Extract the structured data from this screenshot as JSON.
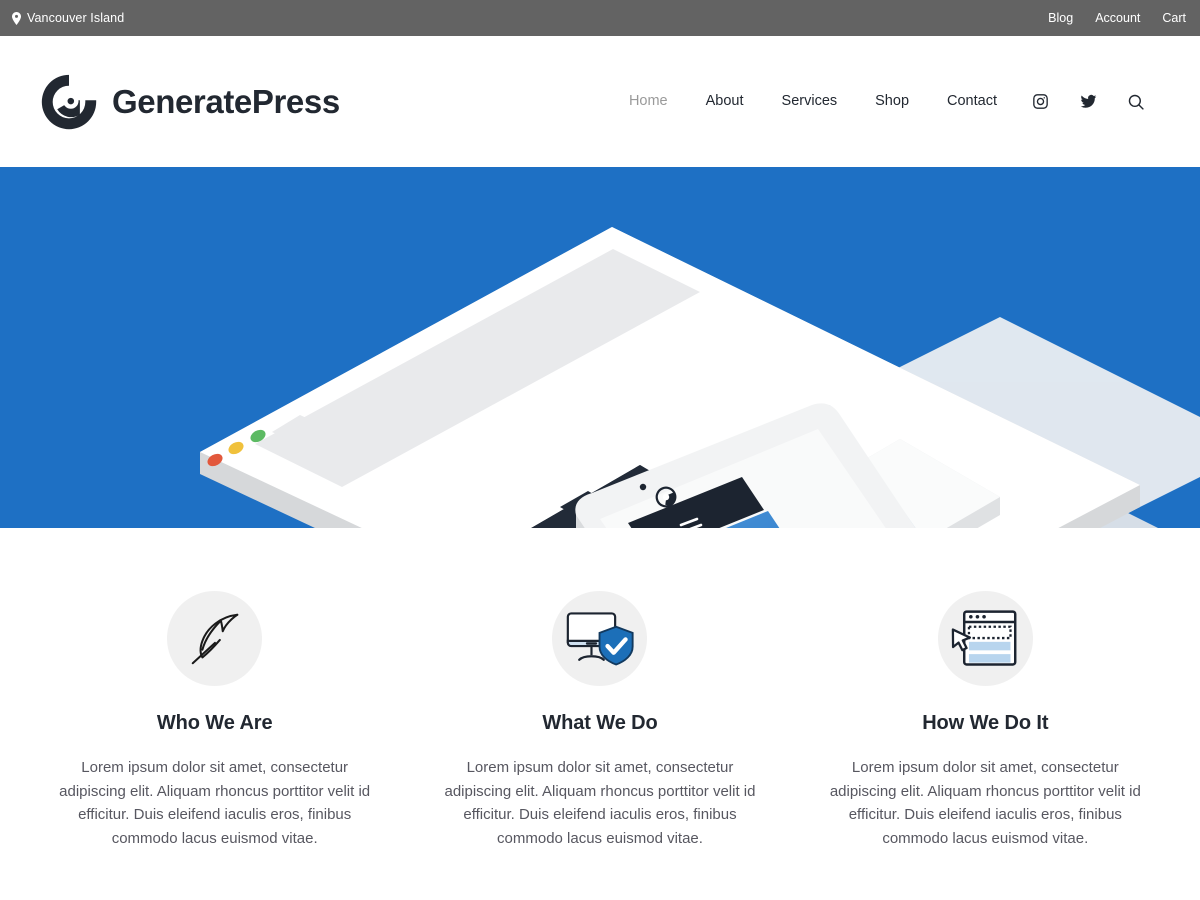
{
  "topbar": {
    "location_icon": "map-pin-icon",
    "location": "Vancouver Island",
    "links": [
      {
        "label": "Blog",
        "name": "blog"
      },
      {
        "label": "Account",
        "name": "account"
      },
      {
        "label": "Cart",
        "name": "cart"
      }
    ]
  },
  "header": {
    "logo_icon": "generatepress-logo-icon",
    "brand_name": "GeneratePress",
    "nav": [
      {
        "label": "Home",
        "current": true
      },
      {
        "label": "About",
        "current": false
      },
      {
        "label": "Services",
        "current": false
      },
      {
        "label": "Shop",
        "current": false
      },
      {
        "label": "Contact",
        "current": false
      }
    ],
    "icons": [
      {
        "name": "instagram-icon",
        "label": "Instagram"
      },
      {
        "name": "twitter-icon",
        "label": "Twitter"
      },
      {
        "name": "search-icon",
        "label": "Search"
      }
    ]
  },
  "hero": {
    "background_color": "#1E70C4",
    "illustration": "isometric-browser-and-phone-mockup",
    "device_dots": [
      "#e8593c",
      "#f2c036",
      "#5cb860"
    ]
  },
  "features": [
    {
      "icon": "feather-quill-icon",
      "title": "Who We Are",
      "text": "Lorem ipsum dolor sit amet, consectetur adipiscing elit. Aliquam rhoncus porttitor velit id efficitur. Duis eleifend iaculis eros, finibus commodo lacus euismod vitae."
    },
    {
      "icon": "monitor-shield-check-icon",
      "title": "What We Do",
      "text": "Lorem ipsum dolor sit amet, consectetur adipiscing elit. Aliquam rhoncus porttitor velit id efficitur. Duis eleifend iaculis eros, finibus commodo lacus euismod vitae."
    },
    {
      "icon": "browser-selection-cursor-icon",
      "title": "How We Do It",
      "text": "Lorem ipsum dolor sit amet, consectetur adipiscing elit. Aliquam rhoncus porttitor velit id efficitur. Duis eleifend iaculis eros, finibus commodo lacus euismod vitae."
    }
  ],
  "colors": {
    "topbar_bg": "#636363",
    "hero_blue": "#1E70C4",
    "text_dark": "#222831",
    "text_body": "#575760",
    "nav_current": "#9a9a9a",
    "icon_circle": "#f0f0f0",
    "shield_blue": "#1c6fb8"
  }
}
